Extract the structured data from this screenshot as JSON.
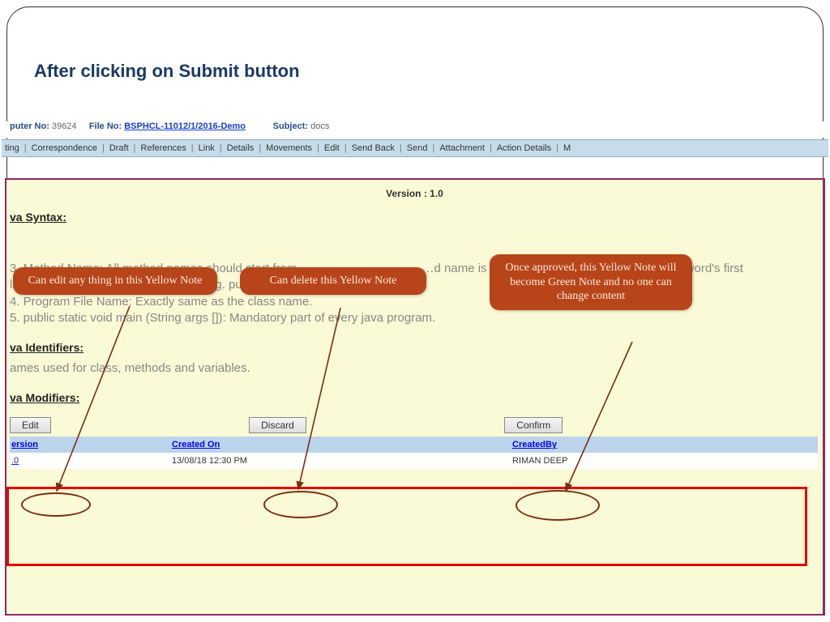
{
  "slide": {
    "title": "After clicking on Submit button"
  },
  "info": {
    "computer_label": "puter No:",
    "computer_val": "39624",
    "file_label": "File No:",
    "file_link": "BSPHCL-11012/1/2016-Demo",
    "subject_label": "Subject:",
    "subject_val": "docs"
  },
  "tabs": [
    "ting",
    "Correspondence",
    "Draft",
    "References",
    "Link",
    "Details",
    "Movements",
    "Edit",
    "Send Back",
    "Send",
    "Attachment",
    "Action Details",
    "M"
  ],
  "version_label": "Version : 1.0",
  "java": {
    "syntax_head": "va Syntax:",
    "line3": "3. Method Name: All method names should start from ……………………………d name is made using several words the inner word's first le………………………………r case, e.g. public void myMethodName.",
    "line4": "4. Program File Name: Exactly same as the class name.",
    "line5": "5. public static void main (String args []): Mandatory part of every java program.",
    "ident_head": "va Identifiers:",
    "ident_body": "ames used for class, methods and variables.",
    "mod_head": "va Modifiers:"
  },
  "buttons": {
    "edit": "Edit",
    "discard": "Discard",
    "confirm": "Confirm"
  },
  "table": {
    "headers": {
      "version": "ersion",
      "created_on": "Created On",
      "created_by": "CreatedBy"
    },
    "row": {
      "version": ".0",
      "created_on": "13/08/18 12:30 PM",
      "created_by": "RIMAN DEEP"
    }
  },
  "callouts": {
    "edit": "Can edit any thing in this Yellow Note",
    "discard": "Can delete this Yellow Note",
    "confirm": "Once approved, this Yellow Note will become Green Note and no one can change content"
  }
}
